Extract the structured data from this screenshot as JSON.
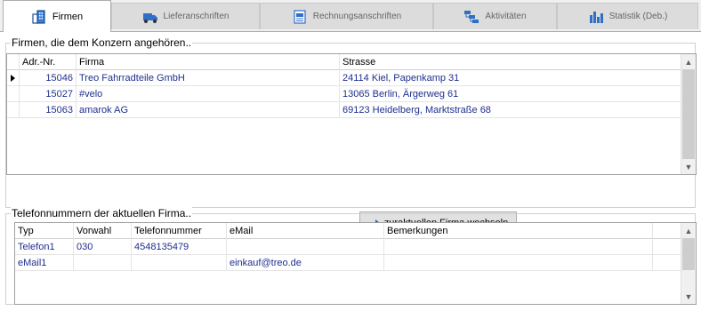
{
  "tabs": [
    {
      "label": "Firmen",
      "icon": "building-icon",
      "active": true
    },
    {
      "label": "Lieferanschriften",
      "icon": "truck-icon",
      "active": false
    },
    {
      "label": "Rechnungsanschriften",
      "icon": "invoice-icon",
      "active": false
    },
    {
      "label": "Aktivitäten",
      "icon": "activity-icon",
      "active": false
    },
    {
      "label": "Statistik (Deb.)",
      "icon": "bar-chart-icon",
      "active": false
    }
  ],
  "companies": {
    "legend": "Firmen, die dem Konzern angehören..",
    "columns": [
      "Adr.-Nr.",
      "Firma",
      "Strasse"
    ],
    "rows": [
      {
        "nr": "15046",
        "firma": "Treo Fahrradteile GmbH",
        "strasse": "24114 Kiel, Papenkamp 31"
      },
      {
        "nr": "15027",
        "firma": "#velo",
        "strasse": "13065 Berlin, Ärgerweg 61"
      },
      {
        "nr": "15063",
        "firma": "amarok AG",
        "strasse": "69123 Heidelberg, Marktstraße 68"
      }
    ]
  },
  "switch_button": {
    "prefix": "zur ",
    "accel": "a",
    "suffix": "ktuellen Firma wechseln"
  },
  "phones": {
    "legend": "Telefonnummern der aktuellen Firma..",
    "columns": [
      "Typ",
      "Vorwahl",
      "Telefonnummer",
      "eMail",
      "Bemerkungen"
    ],
    "rows": [
      {
        "typ": "Telefon1",
        "vorwahl": "030",
        "nummer": "4548135479",
        "email": "",
        "bemerkungen": ""
      },
      {
        "typ": "eMail1",
        "vorwahl": "",
        "nummer": "",
        "email": "einkauf@treo.de",
        "bemerkungen": ""
      }
    ]
  }
}
